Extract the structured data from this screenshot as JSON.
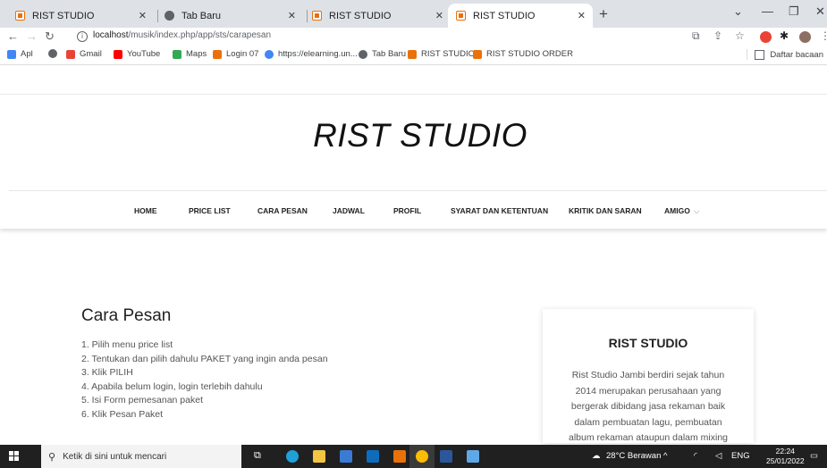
{
  "browser": {
    "tabs": [
      {
        "title": "RIST STUDIO",
        "favicon": "xampp-icon",
        "active": false
      },
      {
        "title": "Tab Baru",
        "favicon": "globe-icon",
        "active": false
      },
      {
        "title": "RIST STUDIO",
        "favicon": "xampp-icon",
        "active": false
      },
      {
        "title": "RIST STUDIO",
        "favicon": "xampp-icon",
        "active": true
      }
    ],
    "new_tab_label": "+",
    "url_host": "localhost",
    "url_path": "/musik/index.php/app/sts/carapesan",
    "bookmarks": [
      {
        "label": "Apl",
        "icon": "apps-grid-icon",
        "color": "#4285f4"
      },
      {
        "label": "",
        "icon": "globe-icon",
        "color": "#5f6368"
      },
      {
        "label": "Gmail",
        "icon": "gmail-icon",
        "color": "#ea4335"
      },
      {
        "label": "YouTube",
        "icon": "youtube-icon",
        "color": "#ff0000"
      },
      {
        "label": "Maps",
        "icon": "maps-icon",
        "color": "#34a853"
      },
      {
        "label": "Login 07",
        "icon": "xampp-icon",
        "color": "#e8710a"
      },
      {
        "label": "https://elearning.un...",
        "icon": "google-icon",
        "color": "#4285f4"
      },
      {
        "label": "Tab Baru",
        "icon": "globe-icon",
        "color": "#5f6368"
      },
      {
        "label": "RIST STUDIO",
        "icon": "xampp-icon",
        "color": "#e8710a"
      },
      {
        "label": "RIST STUDIO ORDER",
        "icon": "xampp-icon",
        "color": "#e8710a"
      }
    ],
    "reading_list_label": "Daftar bacaan"
  },
  "site": {
    "brand": "RIST STUDIO",
    "menu": [
      {
        "label": "HOME"
      },
      {
        "label": "PRICE LIST"
      },
      {
        "label": "CARA PESAN"
      },
      {
        "label": "JADWAL"
      },
      {
        "label": "PROFIL"
      },
      {
        "label": "SYARAT DAN KETENTUAN"
      },
      {
        "label": "KRITIK DAN SARAN"
      },
      {
        "label": "AMIGO",
        "has_dropdown": true
      }
    ]
  },
  "main": {
    "heading": "Cara Pesan",
    "steps": [
      "1. Pilih menu price list",
      "2. Tentukan dan pilih dahulu PAKET yang ingin anda pesan",
      "3. Klik PILIH",
      "4. Apabila belum login, login terlebih dahulu",
      "5. Isi Form pemesanan paket",
      "6. Klik Pesan Paket"
    ]
  },
  "sidebar_card": {
    "title": "RIST STUDIO",
    "lines": [
      "Rist Studio Jambi berdiri sejak tahun",
      "2014 merupakan perusahaan yang",
      "bergerak dibidang jasa rekaman baik",
      "dalam pembuatan lagu, pembuatan",
      "album rekaman ataupun dalam mixing"
    ]
  },
  "taskbar": {
    "search_placeholder": "Ketik di sini untuk mencari",
    "weather": "28°C  Berawan",
    "language": "ENG",
    "time": "22:24",
    "date": "25/01/2022"
  }
}
